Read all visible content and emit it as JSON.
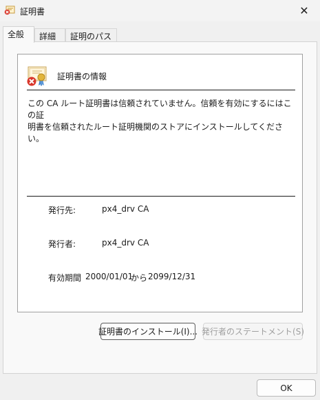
{
  "window": {
    "title": "証明書",
    "close_glyph": "✕"
  },
  "tabs": [
    {
      "label": "全般",
      "active": true
    },
    {
      "label": "詳細",
      "active": false
    },
    {
      "label": "証明のパス",
      "active": false
    }
  ],
  "info": {
    "title": "証明書の情報",
    "message": "この CA ルート証明書は信頼されていません。信頼を有効にするにはこの証\n明書を信頼されたルート証明機関のストアにインストールしてください。",
    "issued_to_label": "発行先:",
    "issued_to_value": "px4_drv CA",
    "issued_by_label": "発行者:",
    "issued_by_value": "px4_drv CA",
    "validity_label": "有効期間",
    "valid_from": "2000/01/01",
    "validity_sep": "から",
    "valid_to": "2099/12/31"
  },
  "buttons": {
    "install": "証明書のインストール(I)...",
    "issuer_statement": "発行者のステートメント(S)",
    "ok": "OK"
  },
  "icons": {
    "app": "certificate-error-icon",
    "cert": "certificate-untrusted-icon",
    "close": "close-icon"
  }
}
